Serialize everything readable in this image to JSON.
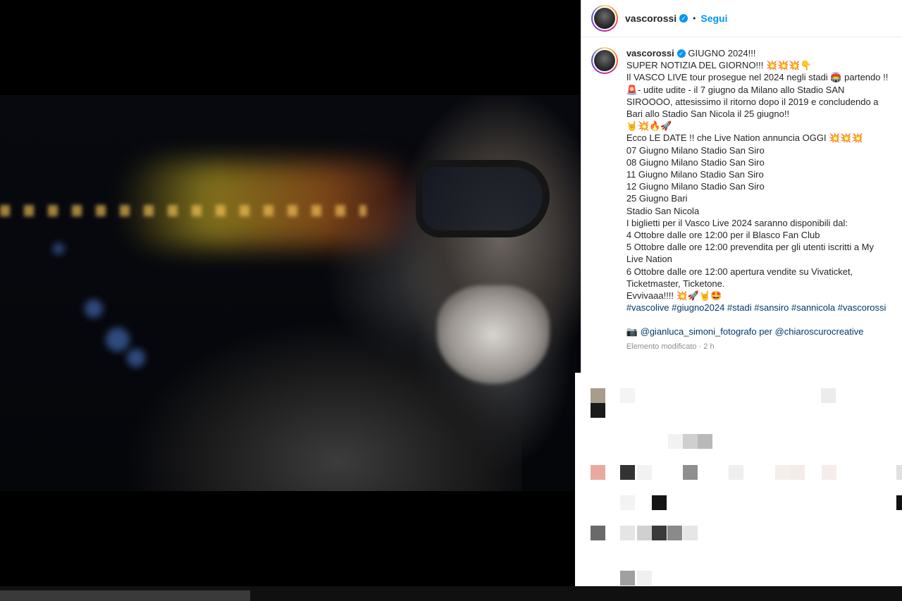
{
  "post": {
    "username": "vascorossi",
    "verified_glyph": "✓",
    "separator": "•",
    "follow_label": "Segui"
  },
  "caption": {
    "username": "vascorossi",
    "lines": [
      " GIUGNO 2024!!!",
      "SUPER NOTIZIA DEL GIORNO!!! 💥💥💥👇",
      "Il VASCO LIVE tour prosegue nel 2024 negli stadi 🏟️ partendo !! 🚨- udite udite - il 7 giugno da Milano allo Stadio SAN SIROOOO, attesissimo il ritorno dopo il 2019 e concludendo a Bari allo Stadio San Nicola il 25 giugno!!",
      "🤘💥🔥🚀",
      "Ecco LE DATE !! che Live Nation annuncia OGGI 💥💥💥",
      "",
      "07 Giugno Milano Stadio San Siro",
      "08 Giugno Milano Stadio San Siro",
      "11 Giugno Milano Stadio San Siro",
      "12 Giugno Milano Stadio San Siro",
      "25 Giugno Bari",
      "Stadio San Nicola",
      "",
      "I biglietti per il Vasco Live 2024 saranno disponibili dal:",
      "4 Ottobre dalle ore 12:00 per il Blasco Fan Club",
      "5 Ottobre dalle ore 12:00 prevendita per gli utenti iscritti a My Live Nation",
      "6 Ottobre dalle ore 12:00 apertura vendite su Vivaticket, Ticketmaster, Ticketone.",
      "Evvivaaa!!!! 💥🚀🤘🤩"
    ],
    "hashtags": "#vascolive #giugno2024 #stadi #sansiro #sannicola #vascorossi",
    "credit_prefix": "📷 @gianluca_simoni_fotografo per ",
    "credit_link": "@chiaroscurocreative",
    "edited_label": "Elemento modificato · 2 h"
  }
}
